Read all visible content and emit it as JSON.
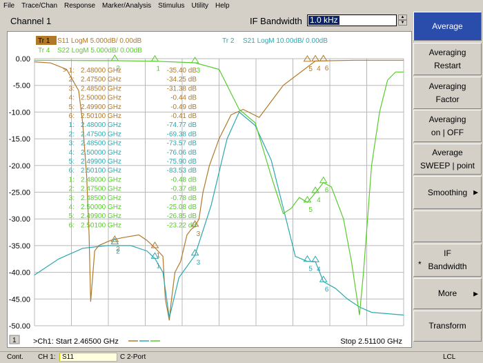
{
  "menu": [
    "File",
    "Trace/Chan",
    "Response",
    "Marker/Analysis",
    "Stimulus",
    "Utility",
    "Help"
  ],
  "toolbar": {
    "channel": "Channel 1",
    "param_label": "IF Bandwidth",
    "param_value": "1.0 kHz"
  },
  "traces": {
    "tr1": {
      "label": "Tr 1",
      "text": "S11 LogM 5.000dB/  0.00dB",
      "color": "#b07828"
    },
    "tr2": {
      "label": "Tr  2",
      "text": "S21 LogM 10.00dB/  0.00dB",
      "color": "#2aa8b0"
    },
    "tr4": {
      "label": "Tr  4",
      "text": "S22 LogM 5.000dB/  0.00dB",
      "color": "#56cc2a"
    }
  },
  "y_axis": [
    "0.00",
    "-5.00",
    "-10.00",
    "-15.00",
    "-20.00",
    "-25.00",
    "-30.00",
    "-35.00",
    "-40.00",
    "-45.00",
    "-50.00"
  ],
  "marker_table": [
    {
      "n": "> 1:",
      "f": "2.48000 GHz",
      "v": "-35.40 dB",
      "tr": "tr1"
    },
    {
      "n": "2:",
      "f": "2.47500 GHz",
      "v": "-34.25 dB",
      "tr": "tr1"
    },
    {
      "n": "3:",
      "f": "2.48500 GHz",
      "v": "-31.38 dB",
      "tr": "tr1"
    },
    {
      "n": "4:",
      "f": "2.50000 GHz",
      "v": "-0.44 dB",
      "tr": "tr1"
    },
    {
      "n": "5:",
      "f": "2.49900 GHz",
      "v": "-0.49 dB",
      "tr": "tr1"
    },
    {
      "n": "6:",
      "f": "2.50100 GHz",
      "v": "-0.41 dB",
      "tr": "tr1"
    },
    {
      "n": "1:",
      "f": "2.48000 GHz",
      "v": "-74.77 dB",
      "tr": "tr2"
    },
    {
      "n": "2:",
      "f": "2.47500 GHz",
      "v": "-69.38 dB",
      "tr": "tr2"
    },
    {
      "n": "3:",
      "f": "2.48500 GHz",
      "v": "-73.57 dB",
      "tr": "tr2"
    },
    {
      "n": "4:",
      "f": "2.50000 GHz",
      "v": "-76.06 dB",
      "tr": "tr2"
    },
    {
      "n": "5:",
      "f": "2.49900 GHz",
      "v": "-75.90 dB",
      "tr": "tr2"
    },
    {
      "n": "6:",
      "f": "2.50100 GHz",
      "v": "-83.53 dB",
      "tr": "tr2"
    },
    {
      "n": "1:",
      "f": "2.48000 GHz",
      "v": "-0.48 dB",
      "tr": "tr4"
    },
    {
      "n": "2:",
      "f": "2.47500 GHz",
      "v": "-0.37 dB",
      "tr": "tr4"
    },
    {
      "n": "3:",
      "f": "2.48500 GHz",
      "v": "-0.78 dB",
      "tr": "tr4"
    },
    {
      "n": "4:",
      "f": "2.50000 GHz",
      "v": "-25.08 dB",
      "tr": "tr4"
    },
    {
      "n": "5:",
      "f": "2.49900 GHz",
      "v": "-26.85 dB",
      "tr": "tr4"
    },
    {
      "n": "6:",
      "f": "2.50100 GHz",
      "v": "-23.22 dB",
      "tr": "tr4"
    }
  ],
  "stimulus": {
    "channel_num": "1",
    "start": ">Ch1: Start  2.46500 GHz",
    "stop": "Stop  2.51100 GHz"
  },
  "softkeys": [
    {
      "label": "Average",
      "active": true
    },
    {
      "label": "Averaging\nRestart"
    },
    {
      "label": "Averaging\nFactor"
    },
    {
      "label": "Averaging\non | OFF"
    },
    {
      "label": "Average\nSWEEP | point"
    },
    {
      "label": "Smoothing",
      "arrow": "▶"
    },
    {
      "label": ""
    },
    {
      "label": "IF\nBandwidth",
      "star": "*"
    },
    {
      "label": "More",
      "arrow": "▶"
    },
    {
      "label": "Transform"
    }
  ],
  "statusbar": {
    "mode": "Cont.",
    "ch": "CH 1:",
    "trace": "S11",
    "cal": "C  2-Port",
    "lcl": "LCL"
  },
  "chart_data": {
    "type": "line",
    "x_range_ghz": [
      2.465,
      2.511
    ],
    "ylim_db": [
      -50,
      0
    ],
    "ylim_tr2_db": [
      -100,
      0
    ],
    "grid": true,
    "series": [
      {
        "name": "S11",
        "color": "#b07828",
        "x": [
          2.465,
          2.467,
          2.469,
          2.4705,
          2.471,
          2.4715,
          2.4718,
          2.472,
          2.4725,
          2.473,
          2.4745,
          2.476,
          2.478,
          2.479,
          2.48,
          2.481,
          2.4813,
          2.4818,
          2.482,
          2.4825,
          2.4832,
          2.484,
          2.4845,
          2.485,
          2.4855,
          2.486,
          2.4868,
          2.488,
          2.4895,
          2.491,
          2.493,
          2.496,
          2.5,
          2.505,
          2.511
        ],
        "y": [
          -0.6,
          -0.8,
          -2,
          -6,
          -12,
          -22,
          -33,
          -45.5,
          -36,
          -35,
          -34,
          -33.5,
          -33,
          -34,
          -35.4,
          -37,
          -45,
          -49,
          -46,
          -40,
          -38,
          -33,
          -32,
          -31.4,
          -30,
          -25,
          -20,
          -15,
          -10.5,
          -9.5,
          -11,
          -5,
          -0.44,
          -0.3,
          -0.3
        ]
      },
      {
        "name": "S21",
        "color": "#2aa8b0",
        "x": [
          2.465,
          2.468,
          2.471,
          2.474,
          2.477,
          2.479,
          2.48,
          2.481,
          2.4818,
          2.483,
          2.485,
          2.487,
          2.489,
          2.4905,
          2.4925,
          2.4945,
          2.4965,
          2.4975,
          2.499,
          2.5,
          2.501,
          2.5025,
          2.504,
          2.5055,
          2.507,
          2.511
        ],
        "y": [
          -81,
          -75,
          -71,
          -70,
          -70,
          -72,
          -74.8,
          -80,
          -97,
          -82,
          -73.6,
          -55,
          -30,
          -20,
          -25,
          -38,
          -62,
          -74,
          -75.9,
          -76,
          -83.5,
          -86,
          -90,
          -93,
          -95,
          -96
        ]
      },
      {
        "name": "S22",
        "color": "#56cc2a",
        "x": [
          2.465,
          2.47,
          2.475,
          2.48,
          2.485,
          2.488,
          2.489,
          2.4905,
          2.4925,
          2.4945,
          2.496,
          2.497,
          2.498,
          2.499,
          2.5,
          2.501,
          2.502,
          2.5035,
          2.5045,
          2.5055,
          2.506,
          2.5065,
          2.507,
          2.508,
          2.509,
          2.51,
          2.511
        ],
        "y": [
          -0.3,
          -0.35,
          -0.37,
          -0.48,
          -0.78,
          -2,
          -5,
          -9.5,
          -12,
          -22,
          -29,
          -28,
          -26,
          -26.9,
          -25.1,
          -23.2,
          -24,
          -30,
          -38,
          -48,
          -40,
          -30,
          -20,
          -10,
          -4,
          -2.5,
          -2.5
        ]
      }
    ],
    "markers": [
      {
        "trace": "S11",
        "labels": [
          "1",
          "2",
          "3",
          "4",
          "5",
          "6"
        ],
        "x": [
          2.48,
          2.475,
          2.485,
          2.5,
          2.499,
          2.501
        ],
        "y": [
          -35.4,
          -34.25,
          -31.38,
          -0.44,
          -0.49,
          -0.41
        ]
      },
      {
        "trace": "S21",
        "labels": [
          "1",
          "2",
          "3",
          "4",
          "5",
          "6"
        ],
        "x": [
          2.48,
          2.475,
          2.485,
          2.5,
          2.499,
          2.501
        ],
        "y": [
          -74.77,
          -69.38,
          -73.57,
          -76.06,
          -75.9,
          -83.53
        ]
      },
      {
        "trace": "S22",
        "labels": [
          "1",
          "2",
          "3",
          "4",
          "5",
          "6"
        ],
        "x": [
          2.48,
          2.475,
          2.485,
          2.5,
          2.499,
          2.501
        ],
        "y": [
          -0.48,
          -0.37,
          -0.78,
          -25.08,
          -26.85,
          -23.22
        ]
      }
    ]
  }
}
